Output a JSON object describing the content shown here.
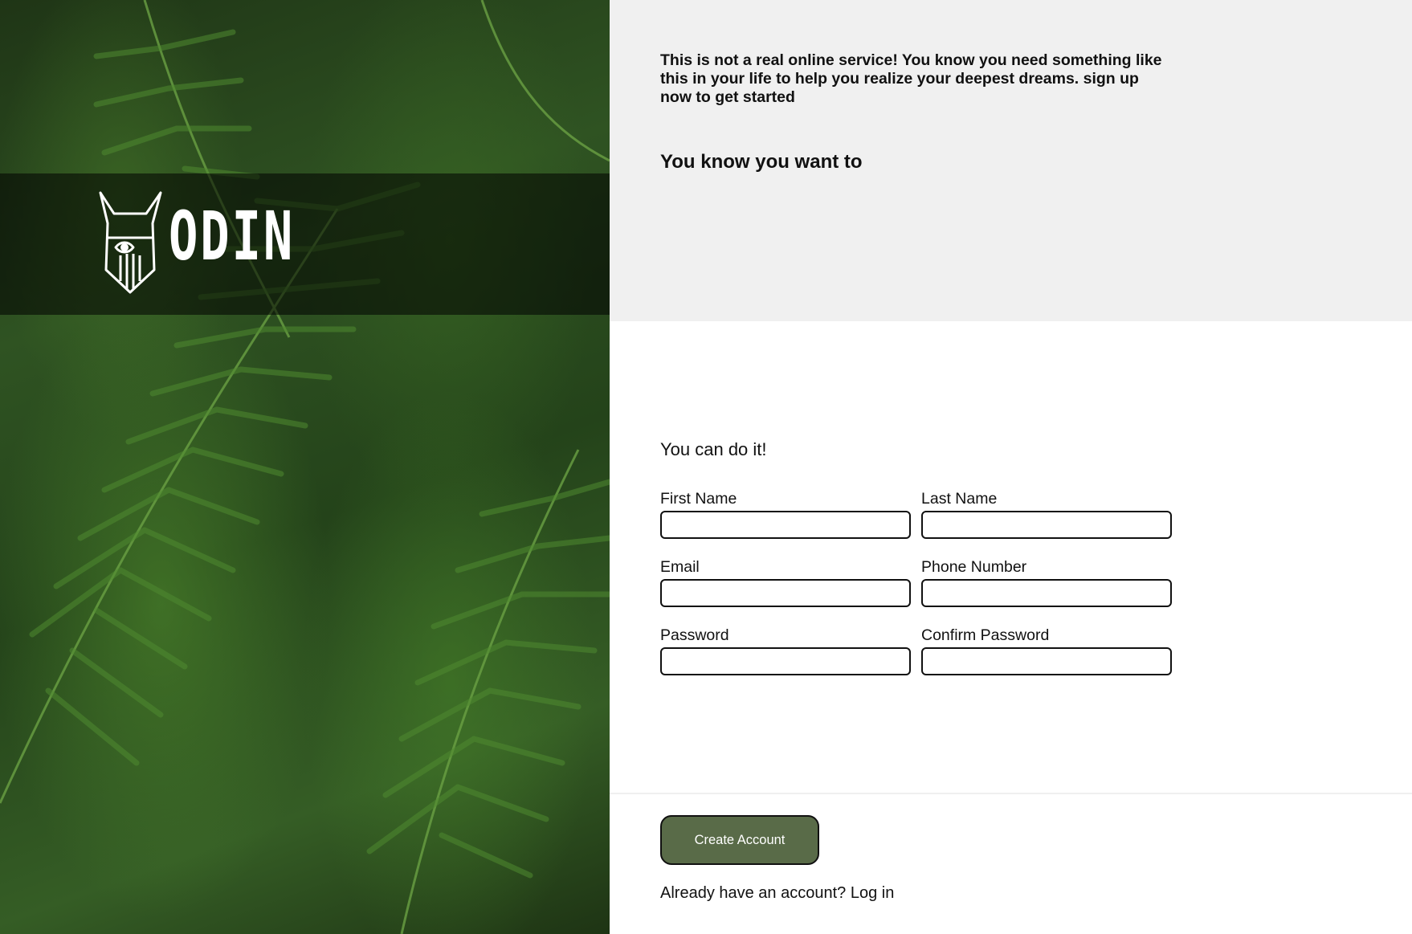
{
  "brand": {
    "logo_text": "ODIN"
  },
  "intro": {
    "text": "This is not a real online service! You know you need something like this in your life to help you realize your deepest dreams. sign up now to get started",
    "tagline": "You know you want to"
  },
  "form": {
    "title": "You can do it!",
    "fields": [
      {
        "label": "First Name"
      },
      {
        "label": "Last Name"
      },
      {
        "label": "Email"
      },
      {
        "label": "Phone Number"
      },
      {
        "label": "Password"
      },
      {
        "label": "Confirm Password"
      }
    ],
    "submit_label": "Create Account"
  },
  "footer": {
    "prompt": "Already have an account?",
    "link": "Log in"
  },
  "colors": {
    "panel": "#f0f0f0",
    "button": "#596b48",
    "fern": "#2f5322"
  }
}
